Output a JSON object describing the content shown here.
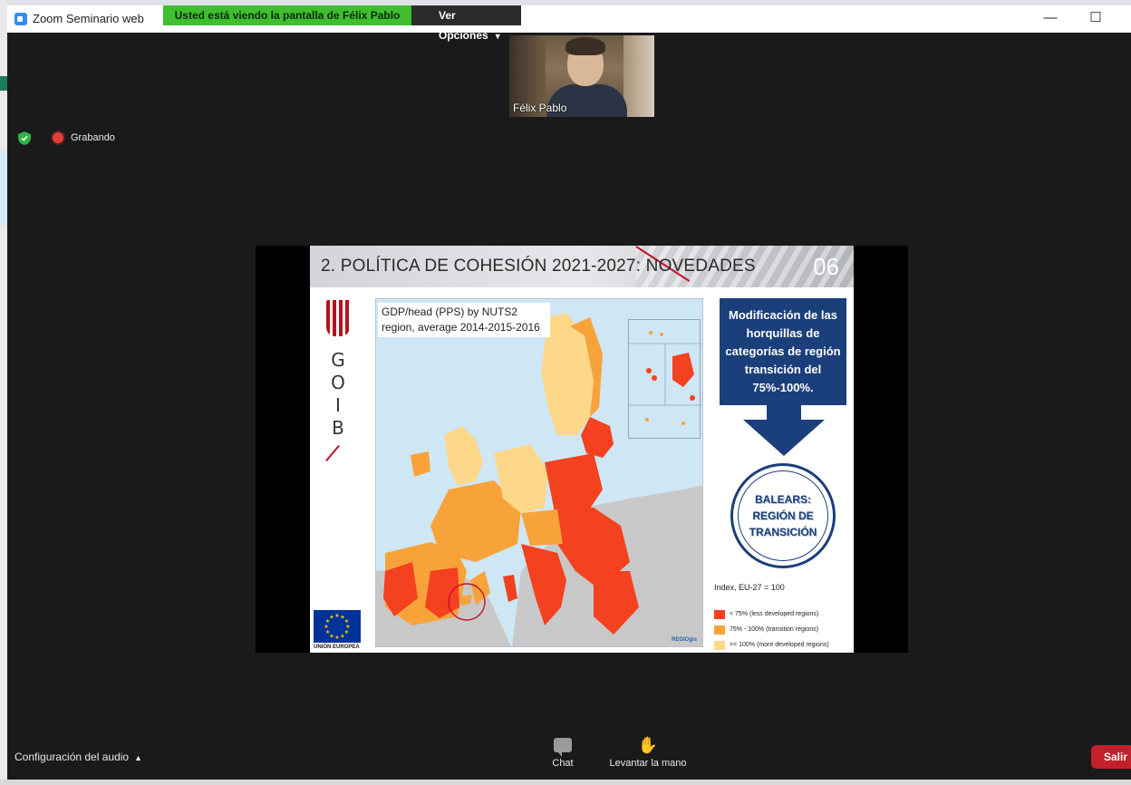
{
  "window": {
    "title": "Zoom Seminario web",
    "minimize_glyph": "—",
    "maximize_glyph": "☐"
  },
  "sharing_banner": {
    "message": "Usted está viendo la pantalla de Félix Pablo",
    "options_label": "Ver Opciones"
  },
  "video": {
    "participant_name": "Félix Pablo"
  },
  "status": {
    "recording_label": "Grabando"
  },
  "slide": {
    "header_title": "2. POLÍTICA DE COHESIÓN 2021-2027: NOVEDADES",
    "header_number": "06",
    "logo_letters": [
      "G",
      "O",
      "I",
      "B"
    ],
    "eu_label": "UNIÓN EUROPEA",
    "map_title": "GDP/head (PPS) by NUTS2 region, average 2014-2015-2016",
    "map_credit": "REGIOgis",
    "callout_text": "Modificación de las horquillas de categorías de región transición del 75%-100%.",
    "badge_text": "BALEARS: REGIÓN DE TRANSICIÓN",
    "legend": {
      "index_label": "Index, EU-27 = 100",
      "items": [
        {
          "label": "< 75% (less developed regions)",
          "color": "#f4411f"
        },
        {
          "label": "75% - 100% (transition regions)",
          "color": "#f7a33a"
        },
        {
          "label": ">= 100% (more developed regions)",
          "color": "#fdd88a"
        }
      ]
    }
  },
  "bottom_bar": {
    "audio_settings_label": "Configuración del audio",
    "chat_label": "Chat",
    "raise_hand_label": "Levantar la mano",
    "exit_label": "Salir"
  },
  "colors": {
    "banner_green": "#3fbe2f",
    "slide_navy": "#1b3f7a",
    "exit_red": "#c2212a"
  }
}
